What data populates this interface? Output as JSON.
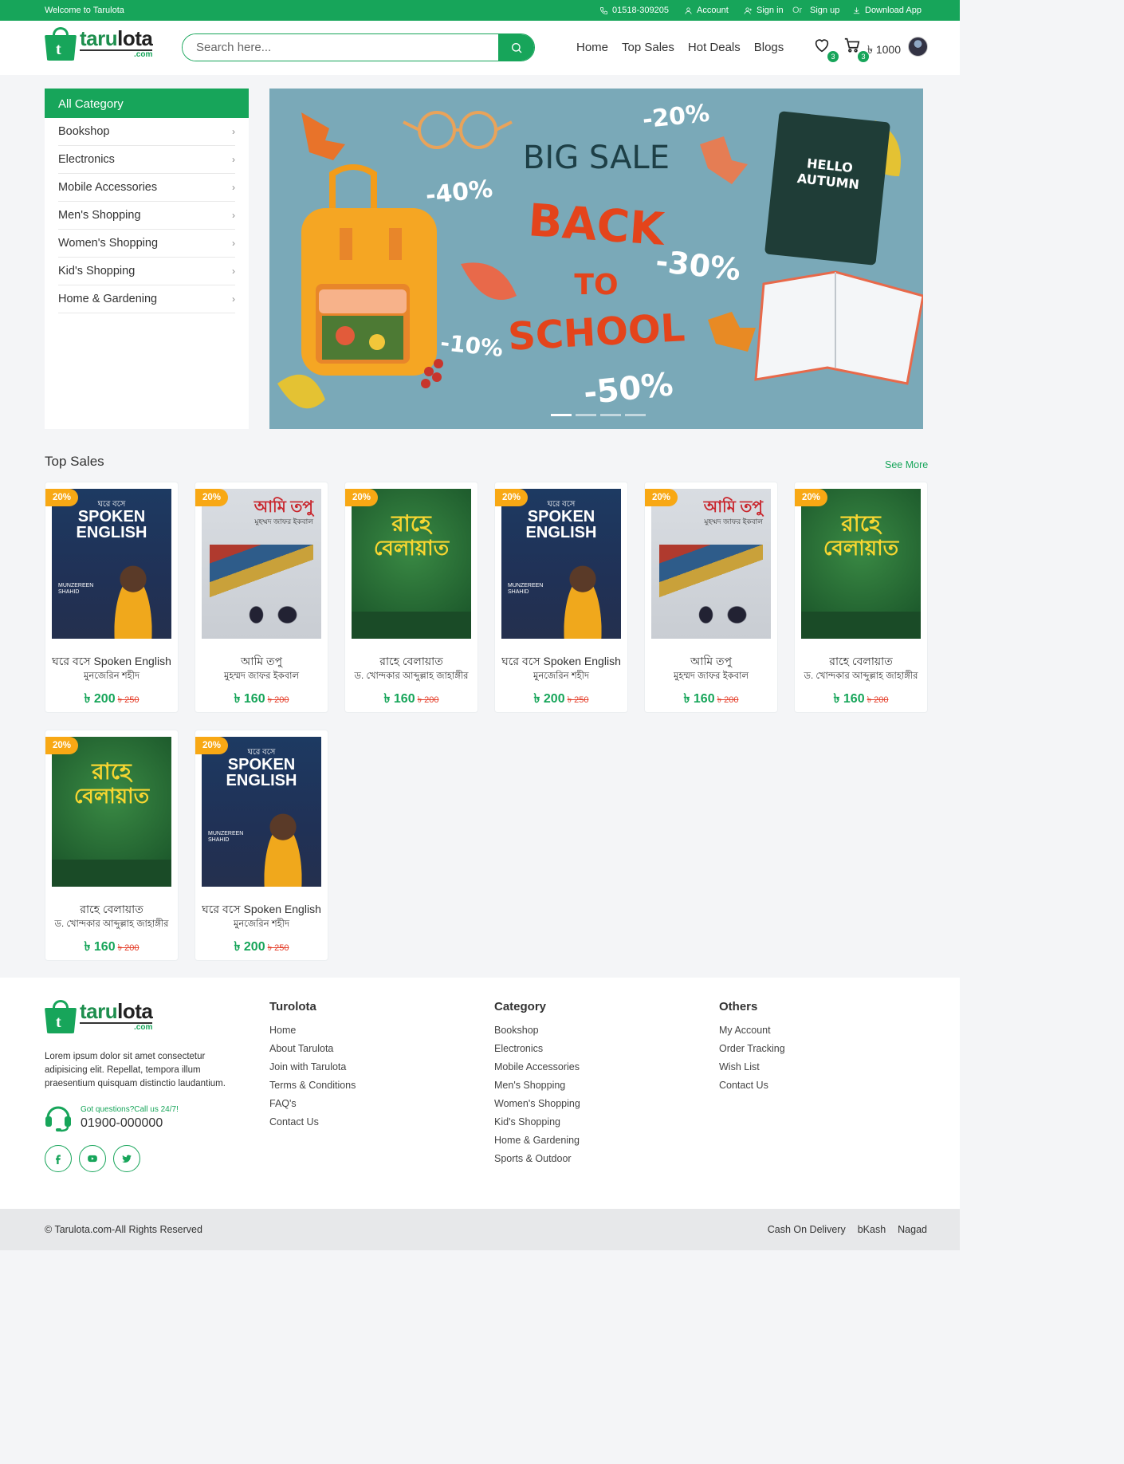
{
  "topbar": {
    "welcome": "Welcome to Tarulota",
    "phone": "01518-309205",
    "account": "Account",
    "sign_in": "Sign in",
    "or": "Or",
    "sign_up": "Sign up",
    "download_app": "Download App"
  },
  "brand": {
    "name_part1": "taru",
    "name_part2": "lota",
    "suffix": ".com",
    "icon_letter": "t",
    "color": "#17a55a"
  },
  "search": {
    "placeholder": "Search here..."
  },
  "nav": {
    "items": [
      "Home",
      "Top Sales",
      "Hot Deals",
      "Blogs"
    ]
  },
  "header_icons": {
    "wishlist_count": "3",
    "cart_count": "3",
    "cart_amount": "৳ 1000"
  },
  "categories": {
    "heading": "All Category",
    "items": [
      "Bookshop",
      "Electronics",
      "Mobile Accessories",
      "Men's Shopping",
      "Women's Shopping",
      "Kid's Shopping",
      "Home & Gardening"
    ]
  },
  "banner": {
    "headline": "BIG SALE",
    "back": "BACK",
    "to": "TO",
    "school": "SCHOOL",
    "discounts": [
      "-20%",
      "-40%",
      "-30%",
      "-10%",
      "-50%"
    ],
    "notebook_text_1": "HELLO",
    "notebook_text_2": "AUTUMN",
    "slide_count": 4,
    "active_slide": 1
  },
  "top_sales": {
    "title": "Top Sales",
    "see_more": "See More",
    "products": [
      {
        "discount": "20%",
        "title": "ঘরে বসে Spoken English",
        "author": "মুনজেরিন শহীদ",
        "price": "৳ 200",
        "old_price": "৳ 250",
        "cover": "a"
      },
      {
        "discount": "20%",
        "title": "আমি তপু",
        "author": "মুহম্মদ জাফর ইকবাল",
        "price": "৳ 160",
        "old_price": "৳ 200",
        "cover": "b"
      },
      {
        "discount": "20%",
        "title": "রাহে বেলায়াত",
        "author": "ড. খোন্দকার আব্দুল্লাহ জাহাঙ্গীর",
        "price": "৳ 160",
        "old_price": "৳ 200",
        "cover": "c"
      },
      {
        "discount": "20%",
        "title": "ঘরে বসে Spoken English",
        "author": "মুনজেরিন শহীদ",
        "price": "৳ 200",
        "old_price": "৳ 250",
        "cover": "a"
      },
      {
        "discount": "20%",
        "title": "আমি তপু",
        "author": "মুহম্মদ জাফর ইকবাল",
        "price": "৳ 160",
        "old_price": "৳ 200",
        "cover": "b"
      },
      {
        "discount": "20%",
        "title": "রাহে বেলায়াত",
        "author": "ড. খোন্দকার আব্দুল্লাহ জাহাঙ্গীর",
        "price": "৳ 160",
        "old_price": "৳ 200",
        "cover": "c"
      },
      {
        "discount": "20%",
        "title": "রাহে বেলায়াত",
        "author": "ড. খোন্দকার আব্দুল্লাহ জাহাঙ্গীর",
        "price": "৳ 160",
        "old_price": "৳ 200",
        "cover": "c"
      },
      {
        "discount": "20%",
        "title": "ঘরে বসে Spoken English",
        "author": "মুনজেরিন শহীদ",
        "price": "৳ 200",
        "old_price": "৳ 250",
        "cover": "a"
      }
    ]
  },
  "covers": {
    "a": {
      "line1": "ঘরে বসে",
      "line2": "SPOKEN",
      "line3": "ENGLISH",
      "author": "MUNZEREEN SHAHID"
    },
    "b": {
      "line1": "আমি তপু",
      "line2": "মুহম্মদ জাফর ইকবাল"
    },
    "c": {
      "line1": "রাহে",
      "line2": "বেলায়াত"
    }
  },
  "footer": {
    "description": "Lorem ipsum dolor sit amet consectetur adipisicing elit. Repellat, tempora illum praesentium quisquam distinctio laudantium.",
    "support_question": "Got questions?Call us 24/7!",
    "support_phone": "01900-000000",
    "columns": [
      {
        "heading": "Turolota",
        "links": [
          "Home",
          "About Tarulota",
          "Join with Tarulota",
          "Terms & Conditions",
          "FAQ's",
          "Contact Us"
        ]
      },
      {
        "heading": "Category",
        "links": [
          "Bookshop",
          "Electronics",
          "Mobile Accessories",
          "Men's Shopping",
          "Women's Shopping",
          "Kid's Shopping",
          "Home & Gardening",
          "Sports & Outdoor"
        ]
      },
      {
        "heading": "Others",
        "links": [
          "My Account",
          "Order Tracking",
          "Wish List",
          "Contact Us"
        ]
      }
    ],
    "social_icons": [
      "facebook-icon",
      "youtube-icon",
      "twitter-icon"
    ]
  },
  "bottom": {
    "copyright": "© Tarulota.com-All Rights Reserved",
    "payments": [
      "Cash On Delivery",
      "bKash",
      "Nagad"
    ]
  }
}
